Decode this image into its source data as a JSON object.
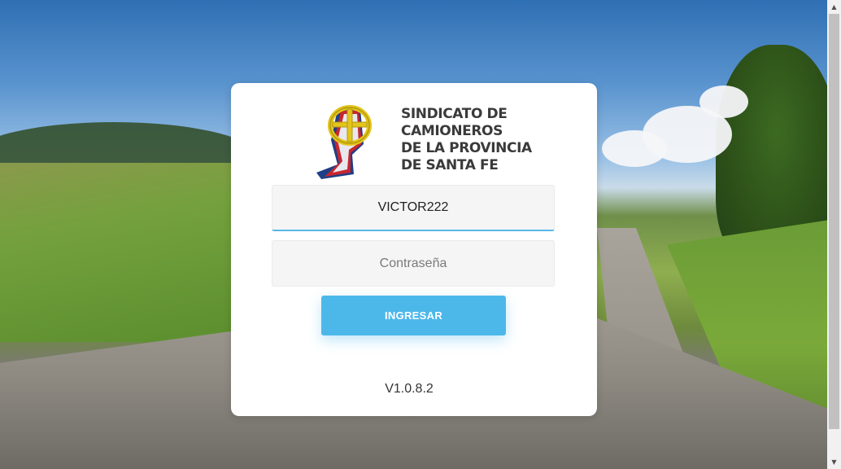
{
  "login": {
    "organization_name_lines": [
      "SINDICATO DE",
      "CAMIONEROS",
      "DE LA PROVINCIA",
      "DE SANTA FE"
    ],
    "username_value": "VICTOR222",
    "password_placeholder": "Contraseña",
    "submit_label": "INGRESAR",
    "version": "V1.0.8.2"
  },
  "colors": {
    "accent": "#4cb8ea",
    "input_focus_border": "#58b8e8",
    "card_background": "#ffffff"
  },
  "icons": {
    "logo_emblem": "sindicato-emblem-icon"
  }
}
